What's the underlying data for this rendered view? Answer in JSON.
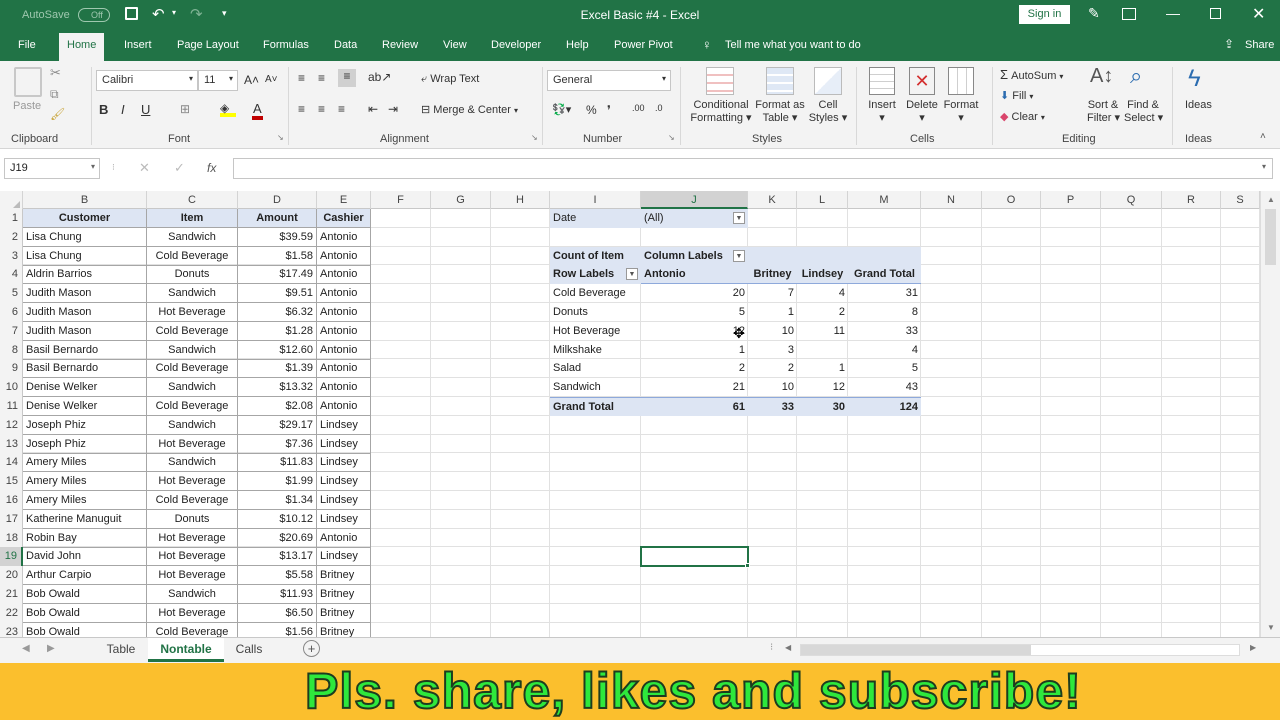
{
  "title": {
    "autosave": "AutoSave",
    "autosave_state": "Off",
    "doc": "Excel Basic #4  -  Excel",
    "signin": "Sign in"
  },
  "tabs": [
    "File",
    "Home",
    "Insert",
    "Page Layout",
    "Formulas",
    "Data",
    "Review",
    "View",
    "Developer",
    "Help",
    "Power Pivot"
  ],
  "tell_me": "Tell me what you want to do",
  "share": "Share",
  "ribbon": {
    "clipboard": {
      "label": "Clipboard",
      "paste": "Paste"
    },
    "font": {
      "label": "Font",
      "name": "Calibri",
      "size": "11"
    },
    "alignment": {
      "label": "Alignment",
      "wrap": "Wrap Text",
      "merge": "Merge & Center"
    },
    "number": {
      "label": "Number",
      "format": "General"
    },
    "styles": {
      "label": "Styles",
      "conditional": "Conditional",
      "conditional2": "Formatting",
      "format_as": "Format as",
      "format_as2": "Table",
      "cell_styles": "Cell",
      "cell_styles2": "Styles"
    },
    "cells": {
      "label": "Cells",
      "insert": "Insert",
      "delete": "Delete",
      "format": "Format"
    },
    "editing": {
      "label": "Editing",
      "autosum": "AutoSum",
      "fill": "Fill",
      "clear": "Clear",
      "sort": "Sort &",
      "sort2": "Filter",
      "find": "Find &",
      "find2": "Select"
    },
    "ideas": {
      "label": "Ideas",
      "btn": "Ideas"
    }
  },
  "formula": {
    "namebox": "J19",
    "fx": "fx"
  },
  "columns": [
    "B",
    "C",
    "D",
    "E",
    "F",
    "G",
    "H",
    "I",
    "J",
    "K",
    "L",
    "M",
    "N",
    "O",
    "P",
    "Q",
    "R",
    "S"
  ],
  "rows": [
    "1",
    "2",
    "3",
    "4",
    "5",
    "6",
    "7",
    "8",
    "9",
    "10",
    "11",
    "12",
    "13",
    "14",
    "15",
    "16",
    "17",
    "18",
    "19",
    "20",
    "21",
    "22",
    "23"
  ],
  "table": {
    "headers": [
      "Customer",
      "Item",
      "Amount",
      "Cashier"
    ],
    "data": [
      [
        "Lisa Chung",
        "Sandwich",
        "$39.59",
        "Antonio"
      ],
      [
        "Lisa Chung",
        "Cold Beverage",
        "$1.58",
        "Antonio"
      ],
      [
        "Aldrin Barrios",
        "Donuts",
        "$17.49",
        "Antonio"
      ],
      [
        "Judith Mason",
        "Sandwich",
        "$9.51",
        "Antonio"
      ],
      [
        "Judith Mason",
        "Hot Beverage",
        "$6.32",
        "Antonio"
      ],
      [
        "Judith Mason",
        "Cold Beverage",
        "$1.28",
        "Antonio"
      ],
      [
        "Basil Bernardo",
        "Sandwich",
        "$12.60",
        "Antonio"
      ],
      [
        "Basil Bernardo",
        "Cold Beverage",
        "$1.39",
        "Antonio"
      ],
      [
        "Denise Welker",
        "Sandwich",
        "$13.32",
        "Antonio"
      ],
      [
        "Denise Welker",
        "Cold Beverage",
        "$2.08",
        "Antonio"
      ],
      [
        "Joseph Phiz",
        "Sandwich",
        "$29.17",
        "Lindsey"
      ],
      [
        "Joseph Phiz",
        "Hot Beverage",
        "$7.36",
        "Lindsey"
      ],
      [
        "Amery Miles",
        "Sandwich",
        "$11.83",
        "Lindsey"
      ],
      [
        "Amery Miles",
        "Hot Beverage",
        "$1.99",
        "Lindsey"
      ],
      [
        "Amery Miles",
        "Cold Beverage",
        "$1.34",
        "Lindsey"
      ],
      [
        "Katherine Manuguit",
        "Donuts",
        "$10.12",
        "Lindsey"
      ],
      [
        "Robin Bay",
        "Hot Beverage",
        "$20.69",
        "Antonio"
      ],
      [
        "David John",
        "Hot Beverage",
        "$13.17",
        "Lindsey"
      ],
      [
        "Arthur Carpio",
        "Hot Beverage",
        "$5.58",
        "Britney"
      ],
      [
        "Bob Owald",
        "Sandwich",
        "$11.93",
        "Britney"
      ],
      [
        "Bob Owald",
        "Hot Beverage",
        "$6.50",
        "Britney"
      ],
      [
        "Bob Owald",
        "Cold Beverage",
        "$1.56",
        "Britney"
      ]
    ]
  },
  "pivot": {
    "filter_label": "Date",
    "filter_value": "(All)",
    "count_label": "Count of Item",
    "col_labels": "Column Labels",
    "row_labels": "Row Labels",
    "cols": [
      "Antonio",
      "Britney",
      "Lindsey",
      "Grand Total"
    ],
    "rows": [
      {
        "label": "Cold Beverage",
        "v": [
          "20",
          "7",
          "4",
          "31"
        ]
      },
      {
        "label": "Donuts",
        "v": [
          "5",
          "1",
          "2",
          "8"
        ]
      },
      {
        "label": "Hot Beverage",
        "v": [
          "12",
          "10",
          "11",
          "33"
        ]
      },
      {
        "label": "Milkshake",
        "v": [
          "1",
          "3",
          "",
          "4"
        ]
      },
      {
        "label": "Salad",
        "v": [
          "2",
          "2",
          "1",
          "5"
        ]
      },
      {
        "label": "Sandwich",
        "v": [
          "21",
          "10",
          "12",
          "43"
        ]
      }
    ],
    "total": {
      "label": "Grand Total",
      "v": [
        "61",
        "33",
        "30",
        "124"
      ]
    }
  },
  "sheets": [
    "Table",
    "Nontable",
    "Calls"
  ],
  "active_sheet": "Nontable",
  "banner": "Pls. share, likes and subscribe!",
  "colors": {
    "excel_green": "#217346",
    "banner_bg": "#fbbf2d",
    "banner_text": "#2ee83c",
    "pivot_header": "#dde5f3"
  }
}
